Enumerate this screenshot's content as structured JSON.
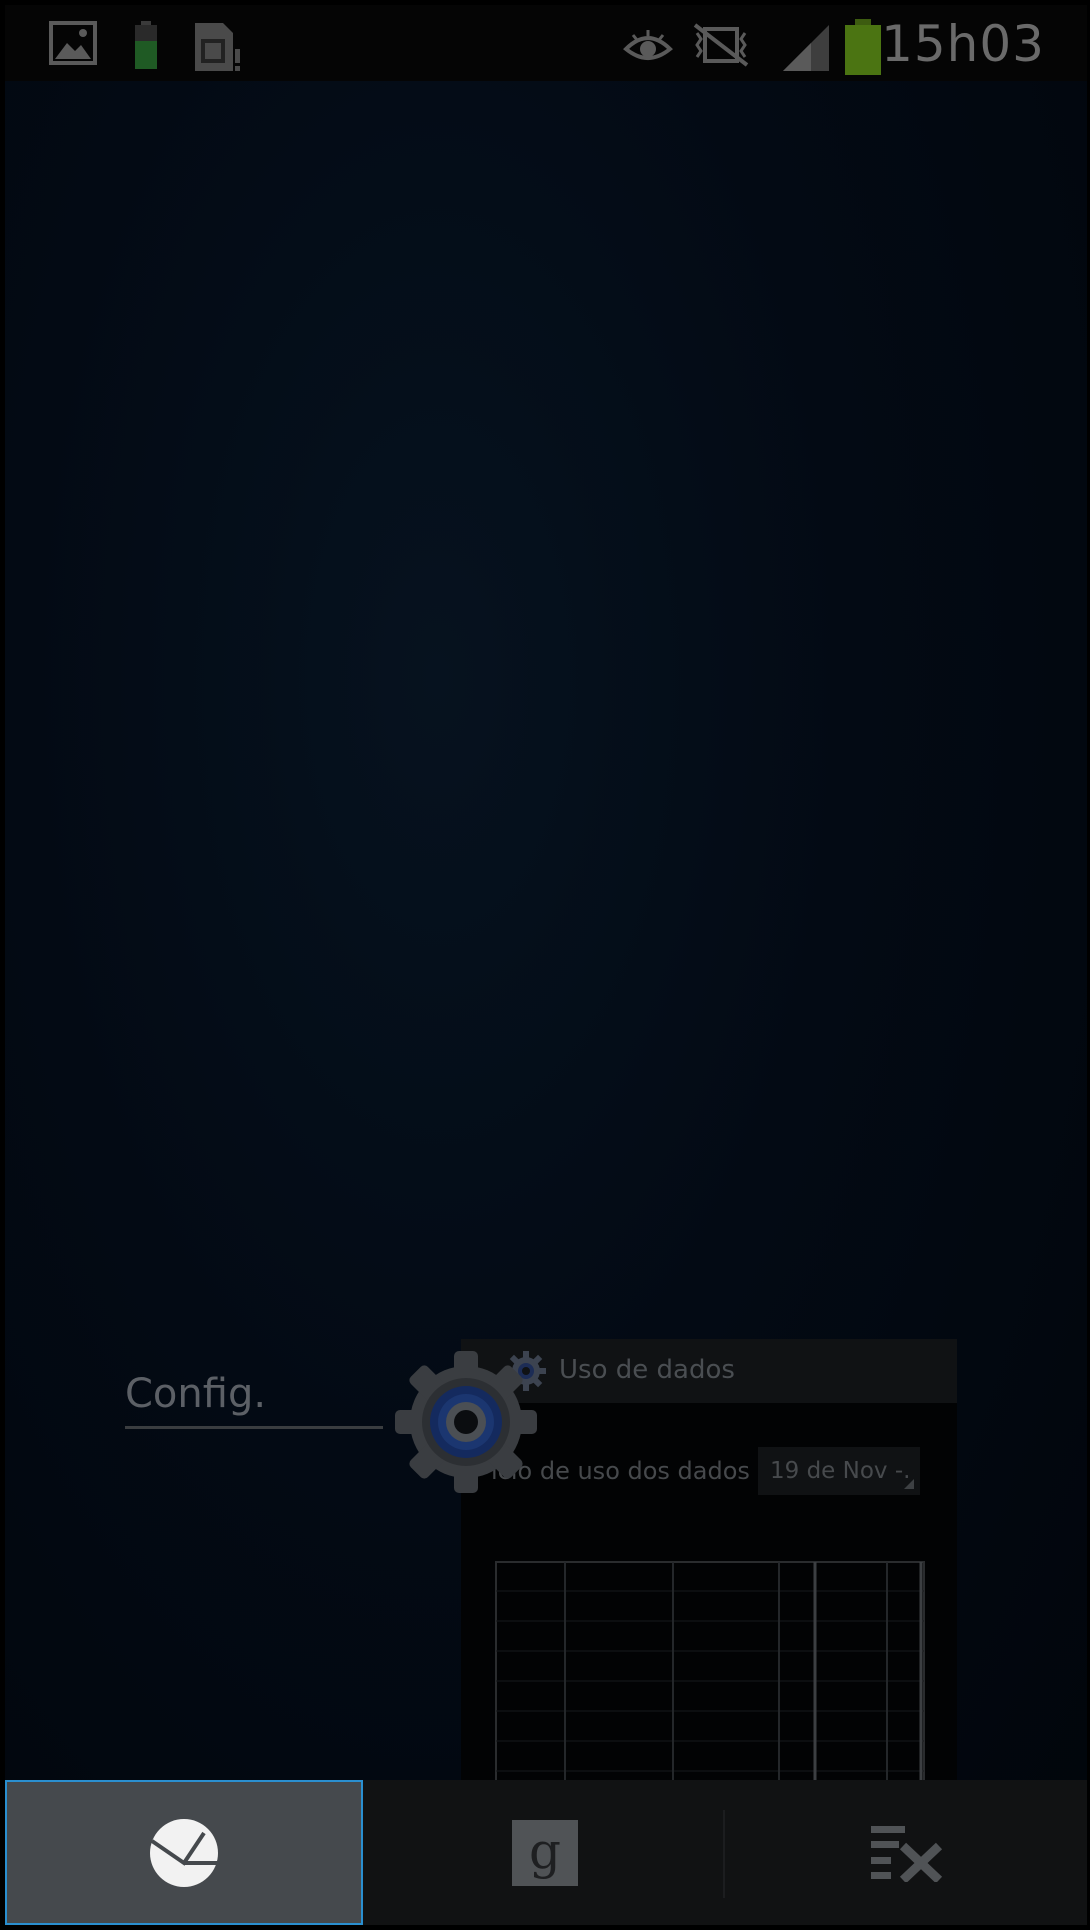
{
  "status_bar": {
    "time": "15h03",
    "icons": [
      "gallery-icon",
      "battery-charging-icon",
      "sim-card-icon",
      "eye-icon",
      "vibrate-mute-icon",
      "signal-icon",
      "battery-icon"
    ]
  },
  "recent_app": {
    "label": "Config.",
    "icon": "settings-gear-icon",
    "thumbnail": {
      "title": "Uso de dados",
      "cycle_label": "iclo de uso dos dados",
      "cycle_value": "19 de Nov -."
    }
  },
  "bottom_bar": {
    "buttons": [
      {
        "name": "task-manager-button",
        "icon": "pie-chart-icon",
        "active": true
      },
      {
        "name": "google-search-button",
        "icon": "google-icon",
        "active": false
      },
      {
        "name": "clear-all-button",
        "icon": "clear-list-icon",
        "active": false
      }
    ]
  },
  "colors": {
    "accent": "#2a8fd0",
    "active_button": "#45494d",
    "bar_background": "#111213"
  }
}
